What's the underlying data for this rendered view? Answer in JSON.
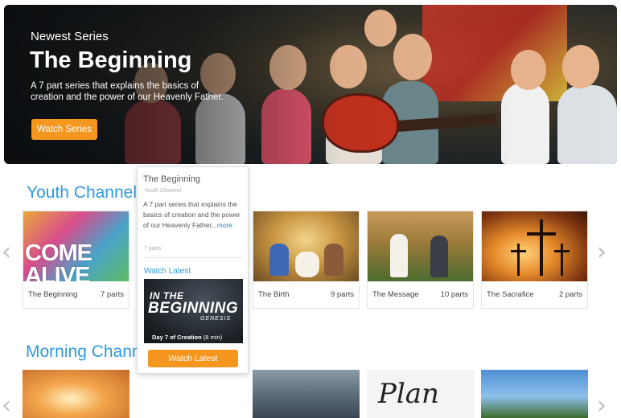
{
  "hero": {
    "kicker": "Newest Series",
    "title": "The Beginning",
    "description": "A 7 part series that explains the basics of creation and the power of our Heavenly Father.",
    "button_label": "Watch Series"
  },
  "youth_channel": {
    "title": "Youth Channel",
    "cards": [
      {
        "title": "The Beginning",
        "parts": "7 parts",
        "thumb_text": "COME ALIVE"
      },
      {
        "title": "The Birth",
        "parts": "9 parts"
      },
      {
        "title": "The Message",
        "parts": "10 parts"
      },
      {
        "title": "The Sacrafice",
        "parts": "2 parts"
      }
    ]
  },
  "morning_channel": {
    "title": "Morning Channel",
    "thumb_text": "Plan"
  },
  "popup": {
    "title": "The Beginning",
    "channel": "Youth Channel",
    "description": "A 7 part series that explains the basics of creation and the power of our Heavenly Father...",
    "more_label": "more",
    "parts": "7 parts",
    "watch_label": "Watch Latest",
    "thumb_line1": "IN THE",
    "thumb_line2": "BEGINNING",
    "thumb_line3": "GENESIS",
    "thumb_caption": "Day 7 of Creation",
    "thumb_duration": "(8 min)",
    "button_label": "Watch Latest"
  },
  "icons": {
    "prev": "chevron-left-icon",
    "next": "chevron-right-icon"
  },
  "colors": {
    "accent": "#f5961e",
    "heading": "#2e9ae0"
  }
}
